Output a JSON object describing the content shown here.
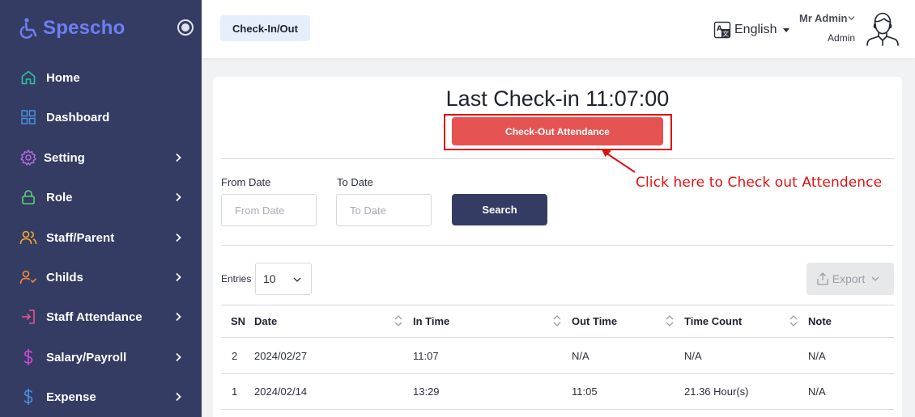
{
  "brand": {
    "name": "Spescho"
  },
  "sidebar": {
    "items": [
      {
        "label": "Home",
        "icon": "home-icon",
        "has_submenu": false
      },
      {
        "label": "Dashboard",
        "icon": "grid-icon",
        "has_submenu": false
      },
      {
        "label": "Setting",
        "icon": "gear-icon",
        "has_submenu": true
      },
      {
        "label": "Role",
        "icon": "lock-icon",
        "has_submenu": true
      },
      {
        "label": "Staff/Parent",
        "icon": "users-icon",
        "has_submenu": true
      },
      {
        "label": "Childs",
        "icon": "user-check-icon",
        "has_submenu": true
      },
      {
        "label": "Staff Attendance",
        "icon": "login-icon",
        "has_submenu": true
      },
      {
        "label": "Salary/Payroll",
        "icon": "dollar-icon",
        "has_submenu": true
      },
      {
        "label": "Expense",
        "icon": "dollar-icon",
        "has_submenu": true
      }
    ]
  },
  "topbar": {
    "tab_label": "Check-In/Out",
    "language": "English",
    "user_name": "Mr Admin",
    "user_role": "Admin"
  },
  "main": {
    "last_checkin": "Last Check-in 11:07:00",
    "checkout_button": "Check-Out Attendance",
    "annotation": "Click here to Check out Attendence",
    "from_date_label": "From Date",
    "from_date_placeholder": "From Date",
    "to_date_label": "To Date",
    "to_date_placeholder": "To Date",
    "search_button": "Search",
    "entries_label": "Entries",
    "entries_value": "10",
    "export_button": "Export"
  },
  "table": {
    "headers": [
      "SN",
      "Date",
      "In Time",
      "Out Time",
      "Time Count",
      "Note"
    ],
    "rows": [
      [
        "2",
        "2024/02/27",
        "11:07",
        "N/A",
        "N/A",
        "N/A"
      ],
      [
        "1",
        "2024/02/14",
        "13:29",
        "11:05",
        "21.36 Hour(s)",
        "N/A"
      ]
    ]
  },
  "colors": {
    "sidebar_bg": "#353c63",
    "brand": "#6d7ff2",
    "checkout_red": "#e55353",
    "annotation_red": "#e01010",
    "primary_dark": "#353c63"
  }
}
